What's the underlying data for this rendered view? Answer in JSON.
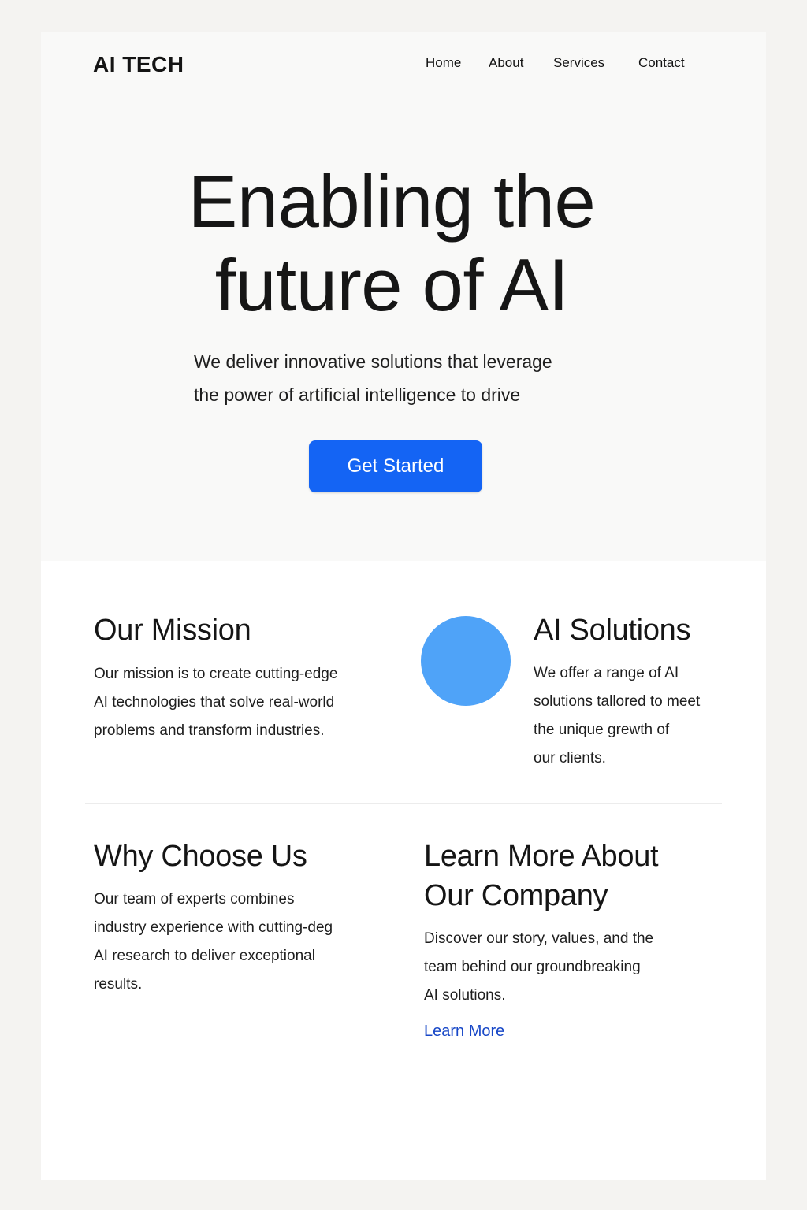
{
  "header": {
    "logo": "AI TECH",
    "nav": [
      "Home",
      "About",
      "Services",
      "Contact"
    ]
  },
  "hero": {
    "title_line1": "Enabling the",
    "title_line2": "future of AI",
    "subtitle_line1": "We deliver innovative solutions that leverage",
    "subtitle_line2": "the power of artificial intelligence to drive",
    "cta_label": "Get Started"
  },
  "sections": {
    "mission": {
      "title": "Our Mission",
      "lines": [
        "Our mission is to create cutting-edge",
        "AI technologies that solve real-world",
        "problems and transform industries."
      ]
    },
    "solutions": {
      "title": "AI Solutions",
      "lines": [
        "We offer a range of AI",
        "solutions tallored to meet",
        "the unique grewth of",
        "our clients."
      ]
    },
    "why": {
      "title": "Why Choose Us",
      "lines": [
        "Our team of experts combines",
        "industry experience with cutting-deg",
        "AI research to deliver exceptional",
        "results."
      ]
    },
    "learn": {
      "title_line1": "Learn More About",
      "title_line2": "Our Company",
      "lines": [
        "Discover our story, values, and the",
        "team behind our groundbreaking",
        "AI solutions."
      ],
      "link_label": "Learn More"
    }
  },
  "colors": {
    "accent": "#1464f4",
    "link": "#1747c7",
    "circle": "#4fa3f8"
  }
}
